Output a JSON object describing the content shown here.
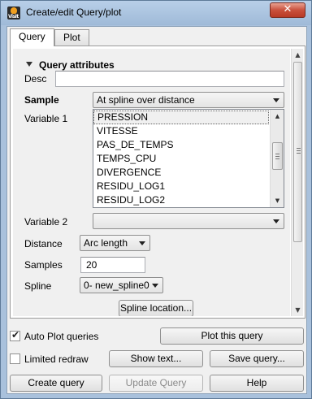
{
  "window": {
    "title": "Create/edit Query/plot",
    "close_glyph": "✕",
    "app_icon_text": "VisIt"
  },
  "tabs": [
    {
      "label": "Query",
      "active": true
    },
    {
      "label": "Plot",
      "active": false
    }
  ],
  "query_attributes": {
    "section_title": "Query attributes",
    "desc_label": "Desc",
    "desc_value": "",
    "sample_label": "Sample",
    "sample_value": "At spline over distance",
    "variable1_label": "Variable  1",
    "variable1_items": [
      "PRESSION",
      "VITESSE",
      "PAS_DE_TEMPS",
      "TEMPS_CPU",
      "DIVERGENCE",
      "RESIDU_LOG1",
      "RESIDU_LOG2"
    ],
    "variable1_selected": "PRESSION",
    "variable2_label": "Variable  2",
    "variable2_value": "",
    "distance_label": "Distance",
    "distance_value": "Arc length",
    "samples_label": "Samples",
    "samples_value": "20",
    "spline_label": "Spline",
    "spline_value": "0- new_spline0",
    "spline_location_button": "Spline location..."
  },
  "footer": {
    "auto_plot_label": "Auto Plot queries",
    "auto_plot_checked": true,
    "plot_query_button": "Plot this query",
    "limited_redraw_label": "Limited redraw",
    "limited_redraw_checked": false,
    "show_text_button": "Show text...",
    "save_query_button": "Save query...",
    "create_query_button": "Create query",
    "update_query_button": "Update Query",
    "help_button": "Help"
  }
}
